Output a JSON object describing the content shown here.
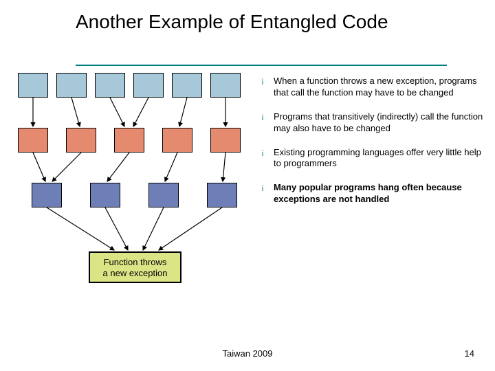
{
  "title": "Another Example of Entangled Code",
  "bullets": [
    "When a function throws a new exception, programs that call the function may have to be changed",
    "Programs that transitively (indirectly) call the function may also have to be changed",
    "Existing programming languages offer very little help to programmers",
    "Many popular programs hang often because exceptions are not handled"
  ],
  "bullet_marker": "¡",
  "func_box": {
    "line1": "Function throws",
    "line2": "a new exception"
  },
  "footer": {
    "center": "Taiwan 2009",
    "page": "14"
  },
  "colors": {
    "accent": "#008080",
    "row1": "#a7c8d8",
    "row2": "#e68a6f",
    "row3": "#6e7fb7",
    "func": "#dbe585"
  }
}
